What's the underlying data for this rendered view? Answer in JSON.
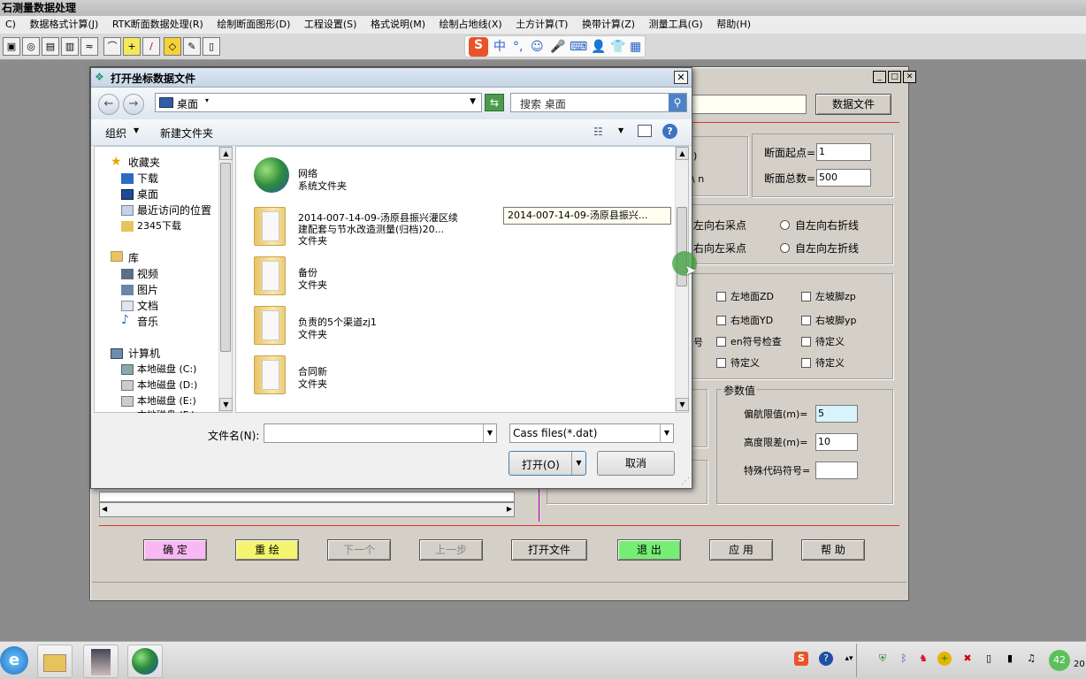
{
  "app": {
    "title": "石测量数据处理",
    "menu": [
      "C)",
      "数据格式计算(J)",
      "RTK断面数据处理(R)",
      "绘制断面图形(D)",
      "工程设置(S)",
      "格式说明(M)",
      "绘制占地线(X)",
      "土方计算(T)",
      "换带计算(Z)",
      "测量工具(G)",
      "帮助(H)"
    ]
  },
  "ime": {
    "logo": "S",
    "items": [
      "中",
      "°,",
      "☺",
      "🎤",
      "⌨",
      "👤",
      "👕",
      "▦"
    ]
  },
  "main": {
    "data_file_button": "数据文件",
    "section_start_label": "断面起点=",
    "section_start_value": "1",
    "section_total_label": "断面总数=",
    "section_total_value": "500",
    "partial_a": ")",
    "partial_b": "\\ n",
    "radio_left_right_pick": "左向右采点",
    "radio_right_left_pick": "右向左采点",
    "radio_left_right_fold": "自左向右折线",
    "radio_left_right_fold2": "自左向左折线",
    "chk_left_ground": "左地面ZD",
    "chk_right_ground": "右地面YD",
    "chk_en_symbol": "en符号检查",
    "chk_tbd1": "待定义",
    "chk_left_slope": "左坡脚zp",
    "chk_right_slope": "右坡脚yp",
    "chk_tbd2": "待定义",
    "chk_tbd3": "待定义",
    "partial_c": "号",
    "params_title": "参数值",
    "offset_label": "偏航限值(m)=",
    "offset_value": "5",
    "height_label": "高度限差(m)=",
    "height_value": "10",
    "special_label": "特殊代码符号=",
    "special_value": "",
    "buttons": {
      "ok": "确 定",
      "redraw": "重 绘",
      "next": "下一个",
      "prev": "上一步",
      "open": "打开文件",
      "exit": "退 出",
      "apply": "应 用",
      "help": "帮 助"
    }
  },
  "file_dialog": {
    "title": "打开坐标数据文件",
    "address": "桌面",
    "search_placeholder": "搜索 桌面",
    "organize": "组织",
    "new_folder": "新建文件夹",
    "nav": {
      "favorites": "收藏夹",
      "downloads": "下载",
      "desktop": "桌面",
      "recent": "最近访问的位置",
      "dl2345": "2345下载",
      "library": "库",
      "videos": "视频",
      "pictures": "图片",
      "documents": "文档",
      "music": "音乐",
      "computer": "计算机",
      "disk_c": "本地磁盘 (C:)",
      "disk_d": "本地磁盘 (D:)",
      "disk_e": "本地磁盘 (E:)",
      "disk_f": "本地磁盘 (F:)"
    },
    "files": [
      {
        "name": "网络",
        "type": "系统文件夹"
      },
      {
        "name": "2014-007-14-09-汤原县振兴灌区续",
        "name2": "建配套与节水改造测量(归档)20...",
        "type": "文件夹"
      },
      {
        "name": "备份",
        "type": "文件夹"
      },
      {
        "name": "负责的5个渠道zj1",
        "type": "文件夹"
      },
      {
        "name": "合同新",
        "type": "文件夹"
      }
    ],
    "tooltip": "2014-007-14-09-汤原县振兴...",
    "filename_label": "文件名(N):",
    "filename_value": "",
    "filter": "Cass files(*.dat)",
    "open_button": "打开(O)",
    "cancel_button": "取消"
  },
  "taskbar": {
    "clock": "20",
    "badge": "42"
  }
}
